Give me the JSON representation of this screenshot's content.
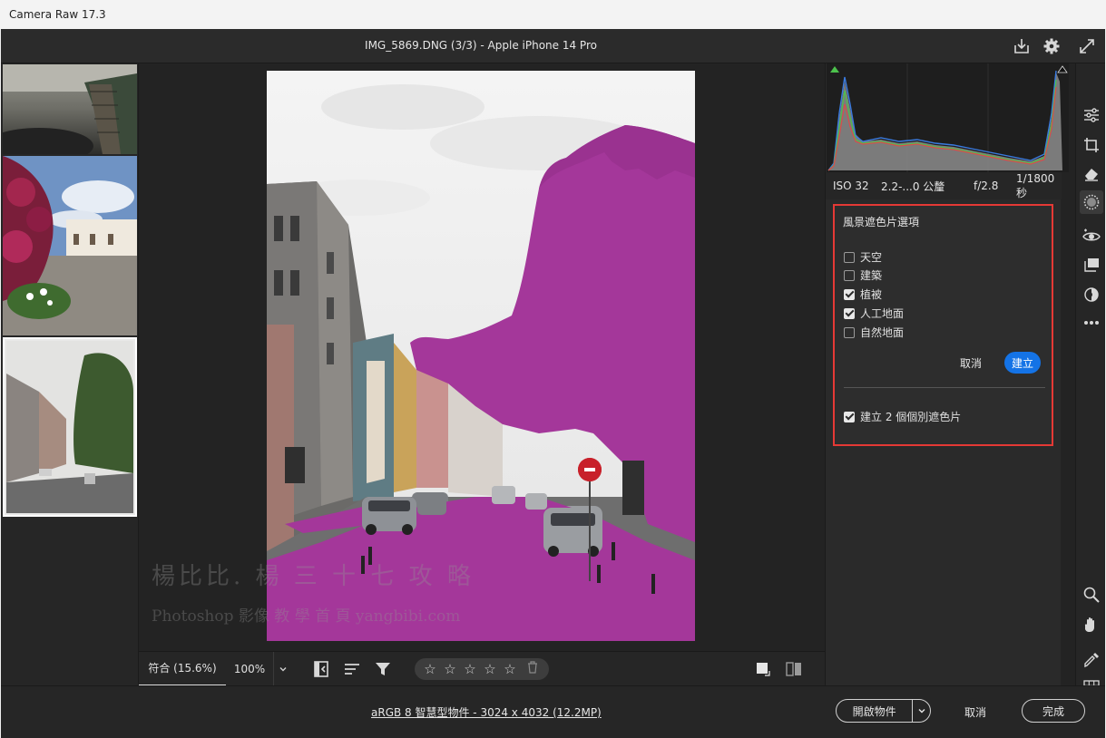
{
  "window": {
    "title": "Camera Raw 17.3"
  },
  "header": {
    "document_title": "IMG_5869.DNG (3/3)  -  Apple iPhone 14 Pro"
  },
  "watermark": {
    "line1": "楊比比. 楊 三 十 七 攻 略",
    "line2": "Photoshop 影像 教 學 首 頁 yangbibi.com"
  },
  "bottombar": {
    "zoom_fit": "符合 (15.6%)",
    "zoom_100": "100%",
    "stars": [
      "☆",
      "☆",
      "☆",
      "☆",
      "☆"
    ]
  },
  "exif": {
    "iso": "ISO 32",
    "focal": "2.2-...0 公釐",
    "aperture": "f/2.8",
    "shutter": "1/1800 秒"
  },
  "landscape_options": {
    "title": "風景遮色片選項",
    "items": [
      {
        "label": "天空",
        "checked": false
      },
      {
        "label": "建築",
        "checked": false
      },
      {
        "label": "植被",
        "checked": true
      },
      {
        "label": "人工地面",
        "checked": true
      },
      {
        "label": "自然地面",
        "checked": false
      }
    ],
    "cancel_label": "取消",
    "create_label": "建立",
    "separate_masks_label": "建立 2 個個別遮色片",
    "separate_masks_checked": true
  },
  "footer": {
    "file_info": "aRGB 8 智慧型物件 - 3024 x 4032 (12.2MP)",
    "open_label": "開啟物件",
    "cancel_label": "取消",
    "done_label": "完成"
  },
  "colors": {
    "accent": "#1473e6",
    "highlight_border": "#e53935",
    "mask_overlay": "#a4379a"
  }
}
